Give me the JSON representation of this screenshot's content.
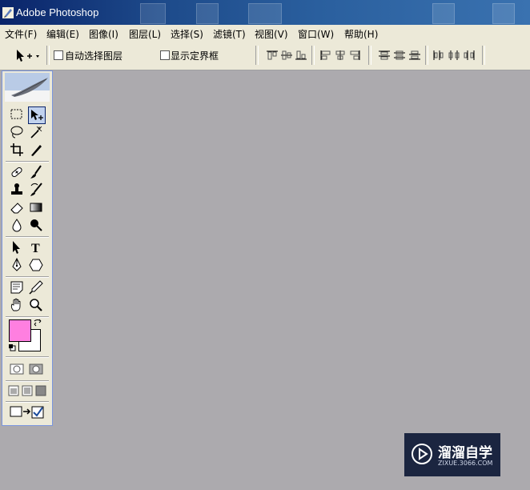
{
  "window": {
    "title": "Adobe Photoshop"
  },
  "menu": [
    {
      "label": "文件(F)"
    },
    {
      "label": "编辑(E)"
    },
    {
      "label": "图像(I)"
    },
    {
      "label": "图层(L)"
    },
    {
      "label": "选择(S)"
    },
    {
      "label": "滤镜(T)"
    },
    {
      "label": "视图(V)"
    },
    {
      "label": "窗口(W)"
    },
    {
      "label": "帮助(H)"
    }
  ],
  "options": {
    "auto_select_label": "自动选择图层",
    "auto_select_checked": false,
    "show_bounds_label": "显示定界框",
    "show_bounds_checked": false
  },
  "colors": {
    "foreground": "#ff7fe0",
    "background": "#ffffff",
    "canvas": "#acaaae"
  },
  "watermark": {
    "title": "溜溜自学",
    "url": "ZIXUE.3066.COM"
  }
}
